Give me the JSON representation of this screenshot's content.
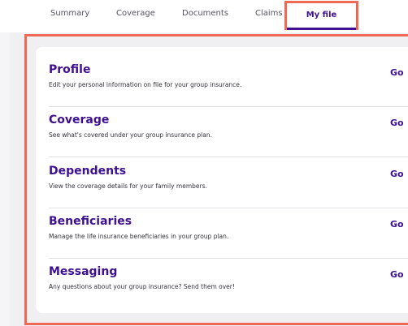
{
  "tabs": [
    {
      "label": "Summary"
    },
    {
      "label": "Coverage"
    },
    {
      "label": "Documents"
    },
    {
      "label": "Claims"
    },
    {
      "label": "My file",
      "active": true
    }
  ],
  "items": [
    {
      "title": "Profile",
      "description": "Edit your personal information on file for your group insurance.",
      "action": "Go"
    },
    {
      "title": "Coverage",
      "description": "See what's covered under your group insurance plan.",
      "action": "Go"
    },
    {
      "title": "Dependents",
      "description": "View the coverage details for your family members.",
      "action": "Go"
    },
    {
      "title": "Beneficiaries",
      "description": "Manage the life insurance beneficiaries in your group plan.",
      "action": "Go"
    },
    {
      "title": "Messaging",
      "description": "Any questions about your group insurance? Send them over!",
      "action": "Go"
    }
  ],
  "colors": {
    "accent": "#3f0f92",
    "highlight": "#ef6a55",
    "background": "#f0f0f3"
  }
}
